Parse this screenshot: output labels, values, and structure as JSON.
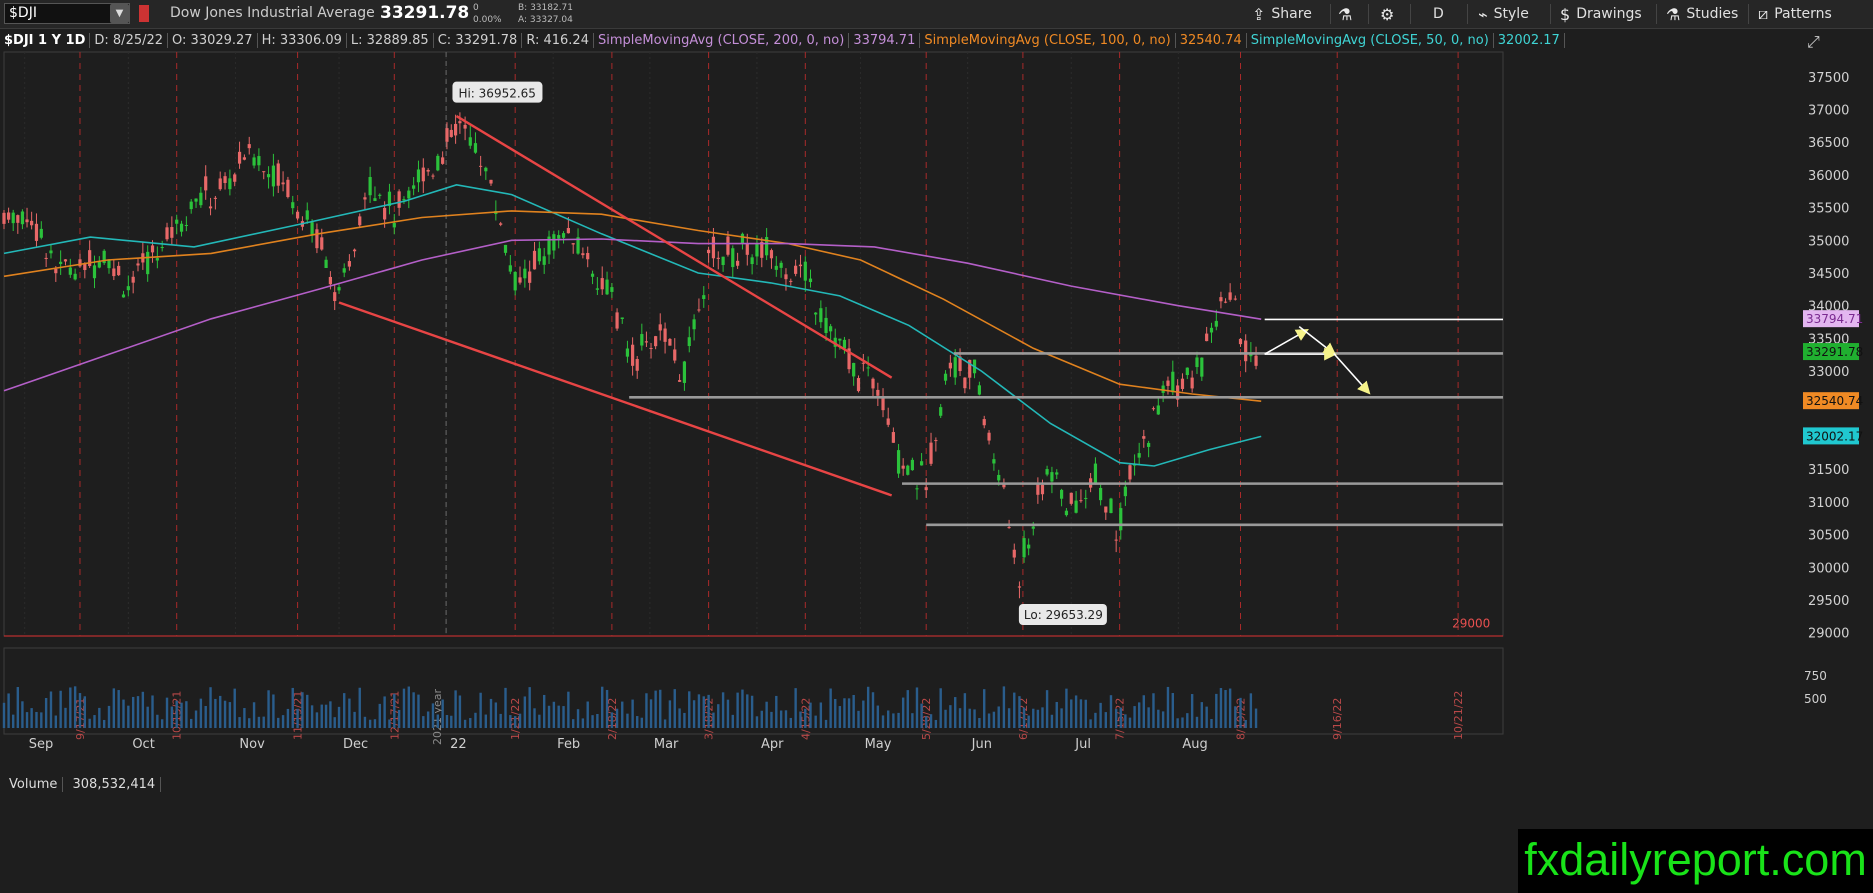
{
  "toolbar": {
    "symbol": "$DJI",
    "instrument_name": "Dow Jones Industrial Average",
    "last_price": "33291.78",
    "change": "0",
    "change_pct": "0.00%",
    "bid": "B: 33182.71",
    "ask": "A: 33327.04",
    "share_label": "Share",
    "period_label": "D",
    "style_label": "Style",
    "drawings_label": "Drawings",
    "studies_label": "Studies",
    "patterns_label": "Patterns",
    "icons": [
      "share-icon",
      "flask-icon",
      "gear-icon",
      "style-icon",
      "drawings-icon",
      "studies-icon",
      "patterns-icon"
    ]
  },
  "infobar": {
    "symbol": "$DJI 1 Y 1D",
    "date": "D: 8/25/22",
    "open": "O: 33029.27",
    "high": "H: 33306.09",
    "low": "L: 32889.85",
    "close": "C: 33291.78",
    "range": "R: 416.24",
    "sma200_label": "SimpleMovingAvg (CLOSE, 200, 0, no)",
    "sma200_value": "33794.71",
    "sma100_label": "SimpleMovingAvg (CLOSE, 100, 0, no)",
    "sma100_value": "32540.74",
    "sma50_label": "SimpleMovingAvg (CLOSE, 50, 0, no)",
    "sma50_value": "32002.17"
  },
  "volume": {
    "label": "Volume",
    "value": "308,532,414",
    "ticks": [
      "750",
      "500"
    ]
  },
  "watermark": "fxdailyreport.com",
  "colors": {
    "background": "#1e1e1e",
    "up": "#2bc23b",
    "down": "#e86868",
    "sma200": "#b45fc8",
    "sma100": "#e0821e",
    "sma50": "#23b8b8",
    "trend": "#e84545",
    "level": "#9a9a9a",
    "watermark": "#19e319"
  },
  "chart_data": {
    "type": "line",
    "title": "$DJI 1 Y 1D",
    "y_axis": {
      "ticks": [
        29000,
        29500,
        30000,
        30500,
        31000,
        31500,
        32000,
        32500,
        33000,
        33500,
        34000,
        34500,
        35000,
        35500,
        36000,
        36500,
        37000,
        37500
      ],
      "ylim": [
        28950,
        37880
      ],
      "side": "right"
    },
    "x_axis": {
      "month_labels": [
        "Sep",
        "Oct",
        "Nov",
        "Dec",
        "22",
        "Feb",
        "Mar",
        "Apr",
        "May",
        "Jun",
        "Jul",
        "Aug"
      ],
      "week_marker_labels": [
        "9/17/21",
        "10/15/21",
        "11/19/21",
        "12/17/21",
        "1/21/22",
        "2/18/22",
        "3/18/22",
        "4/15/22",
        "5/20/22",
        "6/17/22",
        "7/15/22",
        "8/19/22",
        "9/16/22",
        "10/21/22"
      ],
      "year_marker_label": "2021 year",
      "xlim": [
        "2021-08-26",
        "2022-11-03"
      ]
    },
    "series": [
      {
        "name": "SimpleMovingAvg (CLOSE, 50, 0, no)",
        "x": [
          "2021-08-26",
          "2021-09-20",
          "2021-10-20",
          "2021-11-20",
          "2021-12-20",
          "2022-01-04",
          "2022-01-20",
          "2022-02-15",
          "2022-03-15",
          "2022-04-05",
          "2022-04-25",
          "2022-05-15",
          "2022-06-05",
          "2022-06-25",
          "2022-07-15",
          "2022-07-25",
          "2022-08-10",
          "2022-08-25"
        ],
        "y": [
          34800,
          35050,
          34900,
          35250,
          35600,
          35850,
          35700,
          35100,
          34500,
          34350,
          34150,
          33700,
          33000,
          32200,
          31600,
          31550,
          31800,
          32002.17
        ]
      },
      {
        "name": "SimpleMovingAvg (CLOSE, 100, 0, no)",
        "x": [
          "2021-08-26",
          "2021-09-25",
          "2021-10-25",
          "2021-11-25",
          "2021-12-25",
          "2022-01-20",
          "2022-02-15",
          "2022-03-15",
          "2022-04-10",
          "2022-05-01",
          "2022-05-25",
          "2022-06-20",
          "2022-07-15",
          "2022-08-05",
          "2022-08-25"
        ],
        "y": [
          34450,
          34700,
          34800,
          35100,
          35350,
          35450,
          35400,
          35150,
          34950,
          34700,
          34100,
          33350,
          32800,
          32650,
          32540.74
        ]
      },
      {
        "name": "SimpleMovingAvg (CLOSE, 200, 0, no)",
        "x": [
          "2021-08-26",
          "2021-09-25",
          "2021-10-25",
          "2021-11-25",
          "2021-12-25",
          "2022-01-20",
          "2022-02-15",
          "2022-03-15",
          "2022-04-10",
          "2022-05-05",
          "2022-06-01",
          "2022-07-01",
          "2022-08-01",
          "2022-08-25"
        ],
        "y": [
          32700,
          33250,
          33800,
          34250,
          34700,
          35000,
          35020,
          34950,
          34950,
          34900,
          34650,
          34300,
          34000,
          33794.71
        ]
      },
      {
        "name": "Close",
        "x": [
          "2021-08-26",
          "2021-09-03",
          "2021-09-10",
          "2021-09-17",
          "2021-09-24",
          "2021-10-01",
          "2021-10-08",
          "2021-10-15",
          "2021-10-22",
          "2021-10-29",
          "2021-11-05",
          "2021-11-12",
          "2021-11-19",
          "2021-11-26",
          "2021-12-01",
          "2021-12-10",
          "2021-12-17",
          "2021-12-24",
          "2021-12-31",
          "2022-01-05",
          "2022-01-14",
          "2022-01-21",
          "2022-01-28",
          "2022-02-04",
          "2022-02-11",
          "2022-02-18",
          "2022-02-24",
          "2022-03-04",
          "2022-03-11",
          "2022-03-18",
          "2022-03-25",
          "2022-04-01",
          "2022-04-08",
          "2022-04-15",
          "2022-04-21",
          "2022-04-29",
          "2022-05-06",
          "2022-05-12",
          "2022-05-20",
          "2022-05-27",
          "2022-06-03",
          "2022-06-10",
          "2022-06-16",
          "2022-06-24",
          "2022-07-01",
          "2022-07-08",
          "2022-07-14",
          "2022-07-22",
          "2022-07-29",
          "2022-08-05",
          "2022-08-12",
          "2022-08-16",
          "2022-08-22",
          "2022-08-25"
        ],
        "y": [
          35400,
          35350,
          34600,
          34580,
          34800,
          34300,
          34750,
          35290,
          35680,
          35820,
          36330,
          36100,
          35600,
          34900,
          34000,
          35970,
          35360,
          35950,
          36340,
          36800,
          35900,
          34270,
          34720,
          35100,
          34740,
          34080,
          33200,
          33600,
          32950,
          34750,
          34860,
          34820,
          34720,
          34450,
          33800,
          32980,
          32890,
          31730,
          31260,
          33210,
          32900,
          31390,
          29930,
          31500,
          30900,
          31340,
          30640,
          31900,
          32850,
          32800,
          33760,
          34150,
          33060,
          33291.78
        ]
      }
    ],
    "annotations": [
      {
        "text": "Hi: 36952.65",
        "x": "2022-01-04",
        "y": 36952.65
      },
      {
        "text": "Lo: 29653.29",
        "x": "2022-06-17",
        "y": 29653.29
      },
      {
        "text": "29000",
        "x": "2022-10-21",
        "y": 29000
      }
    ],
    "price_labels": [
      {
        "text": "33794.71",
        "y": 33794.71,
        "series": "SimpleMovingAvg (CLOSE, 200, 0, no)"
      },
      {
        "text": "33291.78",
        "y": 33291.78,
        "series": "Close"
      },
      {
        "text": "32540.74",
        "y": 32540.74,
        "series": "SimpleMovingAvg (CLOSE, 100, 0, no)"
      },
      {
        "text": "32002.17",
        "y": 32002.17,
        "series": "SimpleMovingAvg (CLOSE, 50, 0, no)"
      }
    ],
    "trend_lines": [
      {
        "x1": "2022-01-04",
        "y1": 36900,
        "x2": "2022-05-10",
        "y2": 32900
      },
      {
        "x1": "2021-12-01",
        "y1": 34050,
        "x2": "2022-05-10",
        "y2": 31100
      }
    ],
    "horizontal_levels": [
      {
        "y": 33790,
        "x_start": "2022-08-26",
        "color": "white"
      },
      {
        "y": 33270,
        "x_start": "2022-05-28"
      },
      {
        "y": 32600,
        "x_start": "2022-02-23"
      },
      {
        "y": 31280,
        "x_start": "2022-05-13"
      },
      {
        "y": 30650,
        "x_start": "2022-05-20"
      }
    ],
    "projection_arrows": [
      {
        "x1": "2022-08-26",
        "y1": 33260,
        "x2": "2022-09-07",
        "y2": 33620,
        "color": "yellow"
      },
      {
        "x1": "2022-08-26",
        "y1": 33260,
        "x2": "2022-09-15",
        "y2": 33260,
        "color": "yellow"
      },
      {
        "x1": "2022-09-05",
        "y1": 33680,
        "x2": "2022-09-15",
        "y2": 33270,
        "color": "yellow"
      },
      {
        "x1": "2022-09-15",
        "y1": 33270,
        "x2": "2022-09-25",
        "y2": 32680,
        "color": "yellow"
      }
    ]
  }
}
